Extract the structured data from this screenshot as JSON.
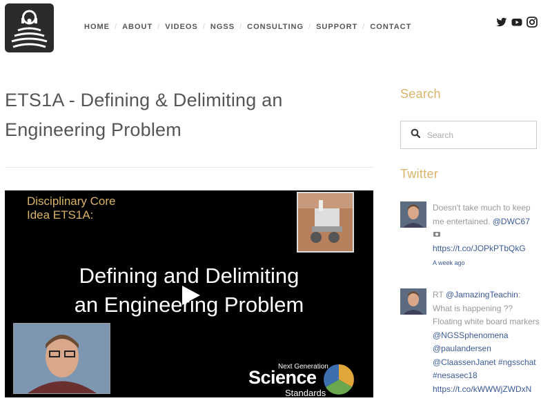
{
  "nav": {
    "items": [
      "HOME",
      "ABOUT",
      "VIDEOS",
      "NGSS",
      "CONSULTING",
      "SUPPORT",
      "CONTACT"
    ]
  },
  "social": [
    "twitter-icon",
    "youtube-icon",
    "instagram-icon"
  ],
  "post": {
    "title": "ETS1A - Defining & Delimiting an Engineering Problem",
    "video": {
      "idea_line1": "Disciplinary Core",
      "idea_line2": "Idea ETS1A:",
      "main_line1": "Defining and Delimiting",
      "main_line2": "an Engineering Problem",
      "ngss_small": "Next Generation",
      "ngss_big": "Science",
      "ngss_std": "Standards"
    }
  },
  "sidebar": {
    "search_title": "Search",
    "search_placeholder": "Search",
    "twitter_title": "Twitter",
    "tweets": [
      {
        "text": "Doesn't take much to keep me entertained. ",
        "mention": "@DWC67",
        "link": "https://t.co/JOPkPTbQkG",
        "time": "A week ago"
      },
      {
        "prefix": "RT ",
        "mention": "@JamazingTeachin",
        "text": ": What is happening ?? Floating white board markers",
        "mention2": "@NGSSphenomena",
        "mention3": "@paulandersen",
        "mention4": "@ClaassenJanet",
        "hashtag1": "#ngsschat",
        "hashtag2": "#nesasec18",
        "link": "https://t.co/kWWWjZWDxN"
      }
    ]
  },
  "colors": {
    "accent": "#d9b46a",
    "link": "#3b5998",
    "text": "#555555"
  }
}
